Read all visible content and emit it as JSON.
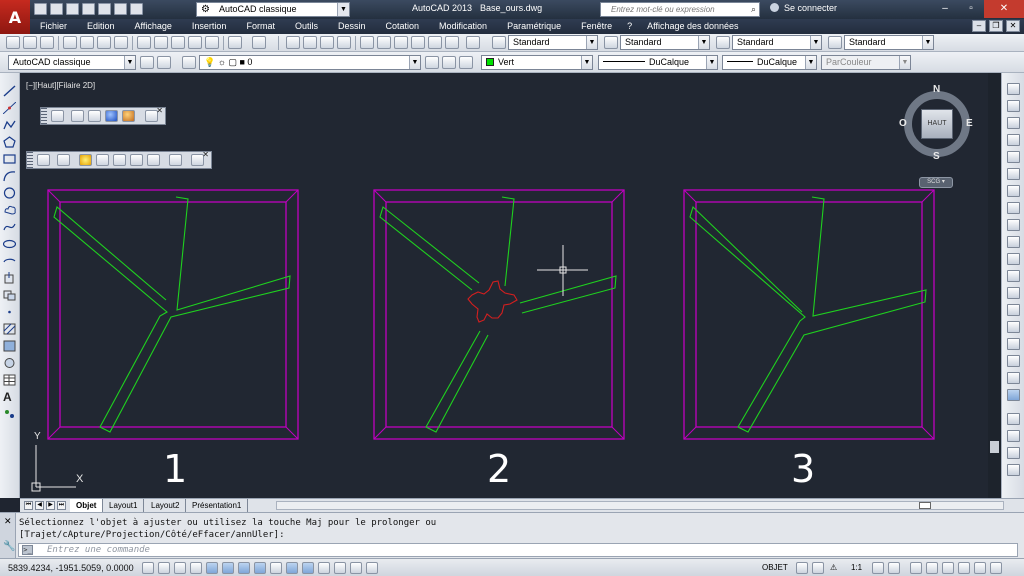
{
  "titlebar": {
    "workspace": "AutoCAD classique",
    "app_name": "AutoCAD 2013",
    "file_name": "Base_ours.dwg",
    "search_placeholder": "Entrez mot-clé ou expression",
    "sign_in": "Se connecter",
    "logo_letter": "A"
  },
  "menu": {
    "items": [
      "Fichier",
      "Edition",
      "Affichage",
      "Insertion",
      "Format",
      "Outils",
      "Dessin",
      "Cotation",
      "Modification",
      "Paramétrique",
      "Fenêtre",
      "?",
      "Affichage des données"
    ]
  },
  "toolbar1": {
    "text_style": "Standard",
    "dim_style": "Standard",
    "table_style": "Standard",
    "mleader_style": "Standard"
  },
  "toolbar2": {
    "workspace": "AutoCAD classique",
    "layer": "0",
    "color": "Vert",
    "linetype": "DuCalque",
    "lineweight": "DuCalque",
    "plotstyle": "ParCouleur",
    "color_hex": "#00e000"
  },
  "canvas": {
    "view_label": "[−][Haut][Filaire 2D]",
    "viewports": [
      "1",
      "2",
      "3"
    ],
    "background": "#212732",
    "frame_color": "#c000c0",
    "shape_color": "#1fd11f",
    "cut_color": "#d41f1f"
  },
  "viewcube": {
    "face": "HAUT",
    "north": "N",
    "south": "S",
    "east": "E",
    "west": "O",
    "ucs_button": "SCG"
  },
  "axes": {
    "x": "X",
    "y": "Y"
  },
  "layout_tabs": [
    "Objet",
    "Layout1",
    "Layout2",
    "Présentation1"
  ],
  "command": {
    "line1": "Sélectionnez l'objet à ajuster ou utilisez la touche Maj pour le prolonger ou",
    "line2": "[Trajet/cApture/Projection/Côté/eFfacer/annUler]:",
    "placeholder": "Entrez une commande"
  },
  "status": {
    "coordinates": "5839.4234, -1951.5059, 0.0000",
    "space": "OBJET",
    "scale": "1:1"
  }
}
